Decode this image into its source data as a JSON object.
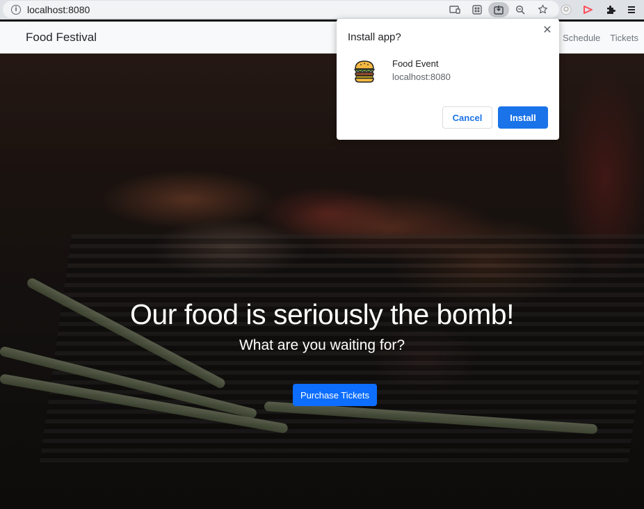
{
  "browser": {
    "url": "localhost:8080",
    "omnibox_icons": [
      "cast-icon",
      "apps-icon",
      "install-app-icon",
      "zoom-icon",
      "bookmark-star-icon"
    ],
    "extension_icons": [
      "extension-avatar-icon",
      "extension-play-icon",
      "puzzle-icon",
      "menu-icon"
    ]
  },
  "navbar": {
    "brand": "Food Festival",
    "links": [
      "Schedule",
      "Tickets"
    ]
  },
  "hero": {
    "title": "Our food is seriously the bomb!",
    "subtitle": "What are you waiting for?",
    "cta_label": "Purchase Tickets"
  },
  "install_dialog": {
    "title": "Install app?",
    "app_name": "Food Event",
    "app_origin": "localhost:8080",
    "cancel_label": "Cancel",
    "install_label": "Install",
    "close_glyph": "✕"
  },
  "colors": {
    "primary": "#0d6efd",
    "chrome_blue": "#1a73e8",
    "navbar_bg": "#f8f9fa",
    "toolbar_bg": "#dee1e6"
  }
}
